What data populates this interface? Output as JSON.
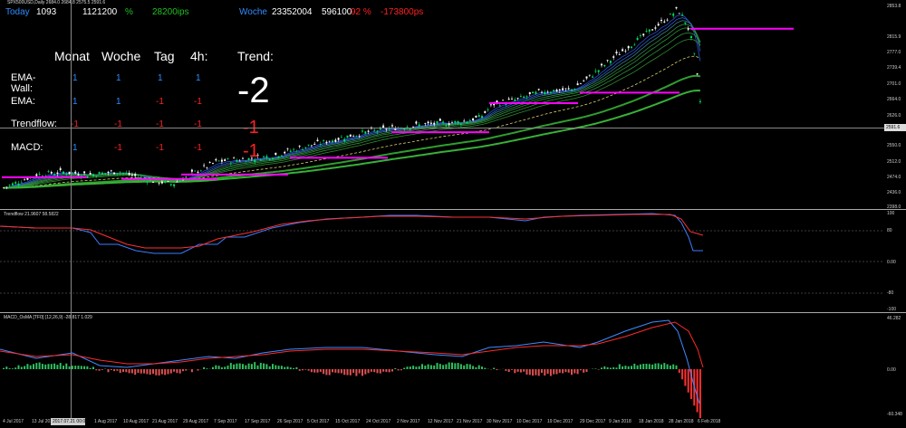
{
  "chart_header": "SPX500USD,Daily  2684.0 2684.8 2575.5 2591.6",
  "top_stats": {
    "today_label": "Today",
    "today_val1": "1093",
    "today_val2": "1121200",
    "today_pct": "%",
    "today_pips": "28200ips",
    "woche_label": "Woche",
    "woche_val1": "23352004",
    "woche_val2": "596100",
    "woche_pct": "92 %",
    "woche_neg": "-173800ps"
  },
  "table": {
    "columns": [
      "Monat",
      "Woche",
      "Tag",
      "4h:"
    ],
    "trend_label": "Trend:",
    "trend_value": "-2",
    "trend_extra1": "-1",
    "trend_extra2": "-1",
    "rows": [
      {
        "label": "EMA-Wall:",
        "values": [
          "1",
          "1",
          "1",
          "1"
        ],
        "colors": [
          "blue",
          "blue",
          "blue",
          "blue"
        ]
      },
      {
        "label": "EMA:",
        "values": [
          "1",
          "1",
          "-1",
          "-1"
        ],
        "colors": [
          "blue",
          "blue",
          "red",
          "red"
        ]
      },
      {
        "label": "Trendflow:",
        "values": [
          "-1",
          "-1",
          "-1",
          "-1"
        ],
        "colors": [
          "red",
          "red",
          "red",
          "red"
        ]
      },
      {
        "label": "MACD:",
        "values": [
          "1",
          "-1",
          "-1",
          "-1"
        ],
        "colors": [
          "blue",
          "red",
          "red",
          "red"
        ]
      }
    ]
  },
  "price_axis": [
    "2853.8",
    "2815.9",
    "2777.0",
    "2739.4",
    "2701.0",
    "2664.0",
    "2626.0",
    "2591.6",
    "2550.0",
    "2512.0",
    "2474.0",
    "2436.0",
    "2398.0"
  ],
  "current_price": "2591.6",
  "trendflow_header": "Trendflow 21.9607 58.5822",
  "trendflow_axis": [
    "100",
    "80",
    "0.00",
    "-80",
    "-100"
  ],
  "macd_header": "MACD_OsMA [TF0] (12,26,9)  -28.817 1.029",
  "macd_axis": [
    "46.282",
    "0.00",
    "-60.348"
  ],
  "dates": [
    "4 Jul 2017",
    "13 Jul 2017",
    "2017.07.21 00:00",
    "1 Aug 2017",
    "10 Aug 2017",
    "21 Aug 2017",
    "29 Aug 2017",
    "7 Sep 2017",
    "17 Sep 2017",
    "26 Sep 2017",
    "5 Oct 2017",
    "15 Oct 2017",
    "24 Oct 2017",
    "2 Nov 2017",
    "12 Nov 2017",
    "21 Nov 2017",
    "30 Nov 2017",
    "10 Dec 2017",
    "19 Dec 2017",
    "29 Dec 2017",
    "9 Jan 2018",
    "18 Jan 2018",
    "28 Jan 2018",
    "6 Feb 2018"
  ],
  "colors": {
    "bull": "#00e060",
    "bear": "#ffffff",
    "ema_fast": "#2f7fff",
    "ema_slow": "#2e9e2e",
    "trend_red": "#ff2020",
    "magenta": "#ff00ff",
    "yellow": "#e8e060"
  }
}
